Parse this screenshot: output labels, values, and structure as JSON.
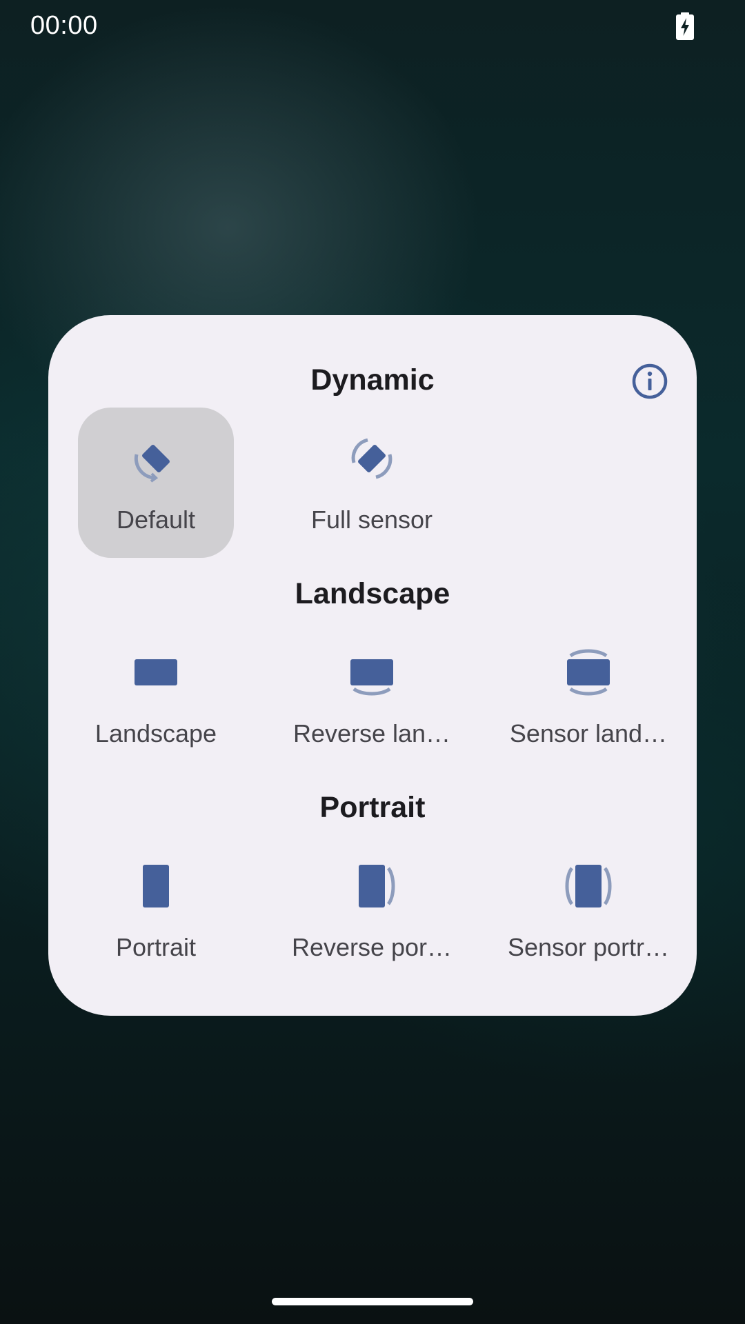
{
  "status_bar": {
    "time": "00:00",
    "battery_icon": "battery-charging-icon"
  },
  "dialog": {
    "info_icon": "info-icon",
    "accent_color": "#45609a",
    "sections": [
      {
        "title": "Dynamic",
        "options": [
          {
            "label": "Default",
            "icon": "rotate-default-icon",
            "selected": true
          },
          {
            "label": "Full sensor",
            "icon": "rotate-full-sensor-icon",
            "selected": false
          }
        ]
      },
      {
        "title": "Landscape",
        "options": [
          {
            "label": "Landscape",
            "icon": "landscape-icon",
            "selected": false
          },
          {
            "label": "Reverse lan…",
            "icon": "reverse-landscape-icon",
            "selected": false
          },
          {
            "label": "Sensor land…",
            "icon": "sensor-landscape-icon",
            "selected": false
          }
        ]
      },
      {
        "title": "Portrait",
        "options": [
          {
            "label": "Portrait",
            "icon": "portrait-icon",
            "selected": false
          },
          {
            "label": "Reverse por…",
            "icon": "reverse-portrait-icon",
            "selected": false
          },
          {
            "label": "Sensor portr…",
            "icon": "sensor-portrait-icon",
            "selected": false
          }
        ]
      }
    ]
  }
}
